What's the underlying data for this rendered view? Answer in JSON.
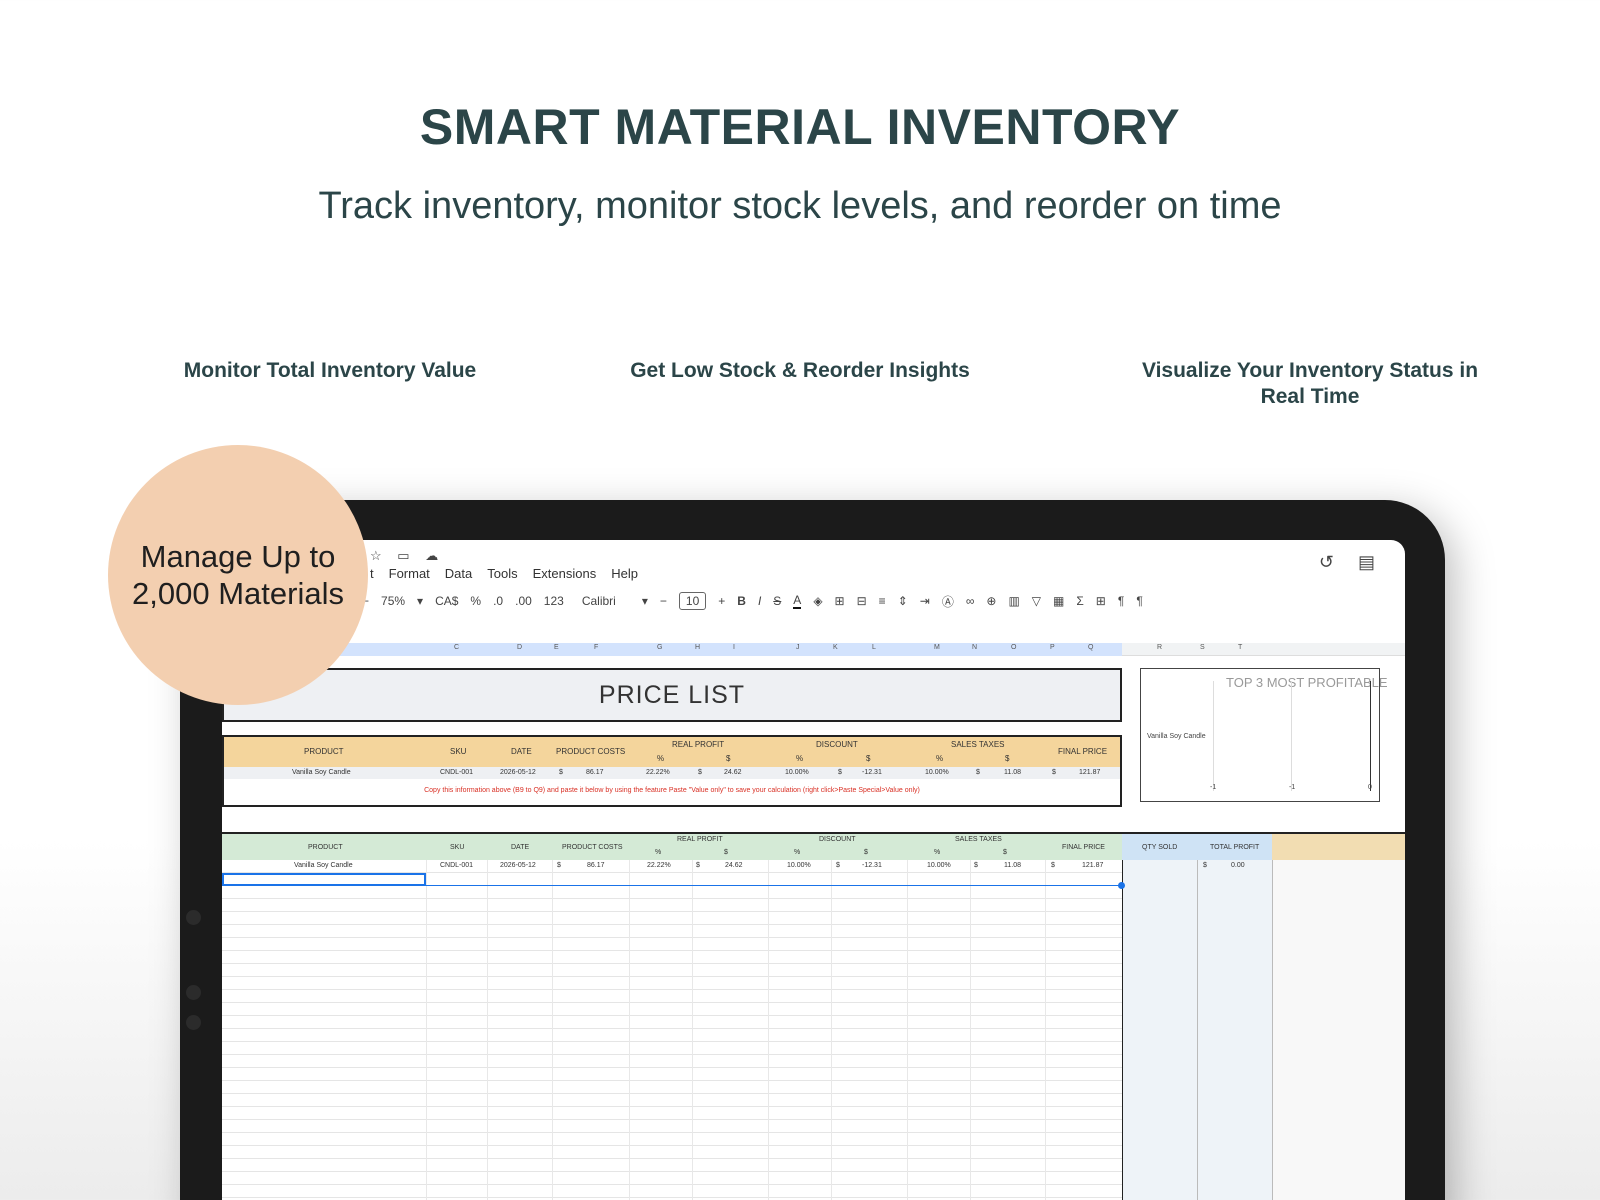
{
  "hero": {
    "title": "SMART MATERIAL INVENTORY",
    "subtitle": "Track inventory, monitor stock levels, and reorder on time"
  },
  "features": [
    "Monitor Total Inventory Value",
    "Get Low Stock & Reorder Insights",
    "Visualize Your Inventory Status in Real Time"
  ],
  "badge": {
    "line1": "Manage Up to",
    "line2": "2,000 Materials"
  },
  "menu": {
    "items": [
      "t",
      "Format",
      "Data",
      "Tools",
      "Extensions",
      "Help"
    ]
  },
  "toolbar": {
    "zoom": "75%",
    "currency": "CA$",
    "percent": "%",
    "dec_less": ".0",
    "dec_more": ".00",
    "number_format": "123",
    "font": "Calibri",
    "font_size": "10",
    "minus": "−",
    "plus": "+",
    "bold": "B",
    "italic": "I",
    "strike": "S",
    "text_color": "A"
  },
  "columns": [
    "C",
    "D",
    "E",
    "F",
    "G",
    "H",
    "I",
    "J",
    "K",
    "L",
    "M",
    "N",
    "O",
    "P",
    "Q",
    "R",
    "S",
    "T"
  ],
  "price_list": {
    "title": "PRICE LIST",
    "headers": {
      "product": "PRODUCT",
      "sku": "SKU",
      "date": "DATE",
      "product_costs": "PRODUCT COSTS",
      "real_profit": "REAL PROFIT",
      "discount": "DISCOUNT",
      "sales_taxes": "SALES TAXES",
      "final_price": "FINAL PRICE",
      "pct": "%",
      "usd": "$"
    },
    "row": {
      "product": "Vanilla Soy Candle",
      "sku": "CNDL-001",
      "date": "2026-05-12",
      "cost_sym": "$",
      "cost": "86.17",
      "profit_pct": "22.22%",
      "profit_sym": "$",
      "profit": "24.62",
      "discount_pct": "10.00%",
      "discount_sym": "$",
      "discount": "-12.31",
      "tax_pct": "10.00%",
      "tax_sym": "$",
      "tax": "11.08",
      "final_sym": "$",
      "final": "121.87"
    },
    "note": "Copy this information above (B9 to Q9) and paste it below by using the feature Paste \"Value only\" to save your calculation (right click>Paste Special>Value only)"
  },
  "chart": {
    "title": "TOP 3 MOST PROFITABLE",
    "label": "Vanilla Soy Candle",
    "ticks": [
      "-1",
      "-1",
      "0"
    ]
  },
  "sales_table": {
    "headers": {
      "product": "PRODUCT",
      "sku": "SKU",
      "date": "DATE",
      "product_costs": "PRODUCT COSTS",
      "real_profit": "REAL PROFIT",
      "discount": "DISCOUNT",
      "sales_taxes": "SALES TAXES",
      "final_price": "FINAL PRICE",
      "qty_sold": "QTY SOLD",
      "total_profit": "TOTAL PROFIT",
      "pct": "%",
      "usd": "$"
    },
    "row": {
      "product": "Vanilla Soy Candle",
      "sku": "CNDL-001",
      "date": "2026-05-12",
      "cost_sym": "$",
      "cost": "86.17",
      "profit_pct": "22.22%",
      "profit_sym": "$",
      "profit": "24.62",
      "discount_pct": "10.00%",
      "discount_sym": "$",
      "discount": "-12.31",
      "tax_pct": "10.00%",
      "tax_sym": "$",
      "tax": "11.08",
      "final_sym": "$",
      "final": "121.87",
      "total_sym": "$",
      "total_profit": "0.00"
    }
  },
  "colors": {
    "title": "#2b4548",
    "badge": "#f3cfb0",
    "price_header": "#f4d59c",
    "sales_header": "#d4ead6",
    "note_red": "#d93025",
    "selection": "#1a73e8"
  }
}
